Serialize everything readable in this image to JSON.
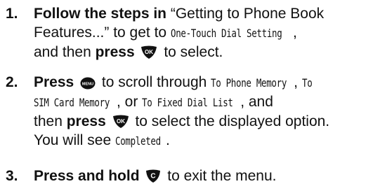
{
  "steps": [
    {
      "number": "1.",
      "line1_bold": "Follow the steps in",
      "line1_quote": "“Getting to Phone Book",
      "line2_quote": "Features...” to get to",
      "line2_lcd": "One-Touch Dial Setting",
      "line2_tail": ",",
      "line3_pre": "and then",
      "line3_bold": "press",
      "line3_key": "ok-key-icon",
      "line3_tail": "to select."
    },
    {
      "number": "2.",
      "line1_bold": "Press",
      "line1_key": "menu-key-icon",
      "line1_text": "to scroll through",
      "line1_lcd1": "To Phone Memory",
      "line1_sep": ",",
      "line1_lcd2": "To",
      "line2_lcd1": "SIM Card Memory",
      "line2_text": ", or",
      "line2_lcd2": "To Fixed Dial List",
      "line2_tail": ", and",
      "line3_pre": "then",
      "line3_bold": "press",
      "line3_key": "ok-key-icon",
      "line3_tail": "to select the displayed option.",
      "line4_pre": "You will see",
      "line4_lcd": "Completed",
      "line4_tail": "."
    },
    {
      "number": "3.",
      "line1_bold": "Press and hold",
      "line1_key": "clear-key-icon",
      "line1_tail": "to exit the menu."
    }
  ]
}
